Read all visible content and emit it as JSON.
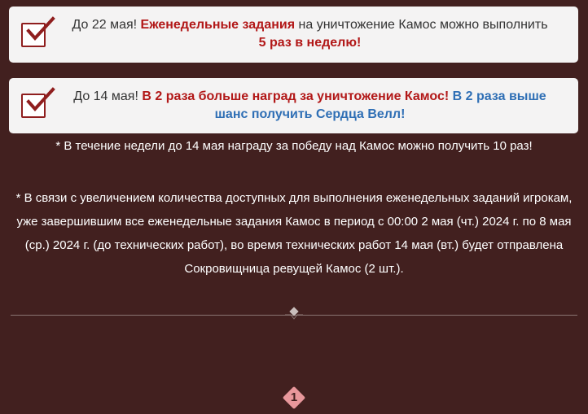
{
  "notice_1": {
    "prefix": "До 22 мая! ",
    "highlight_red": "Еженедельные задания",
    "middle": " на уничтожение Камос можно выполнить",
    "line2_red": "5 раз в неделю!"
  },
  "notice_2": {
    "prefix": "До 14 мая! ",
    "highlight_red": "В 2 раза больше наград за уничтожение Камос!",
    "space": " ",
    "highlight_blue": "В 2 раза выше шанс получить Сердца Велл!"
  },
  "footnote_1": "* В течение недели до 14 мая награду за победу над Камос можно получить 10 раз!",
  "footnote_2": "* В связи с увеличением количества доступных для выполнения еженедельных заданий игрокам, уже завершившим все еженедельные задания Камос в период с 00:00 2 мая (чт.) 2024 г. по 8 мая (ср.) 2024 г. (до технических работ), во время технических работ 14 мая (вт.) будет отправлена Сокровищница ревущей Камос (2 шт.).",
  "pagination": {
    "current_page": "1"
  },
  "colors": {
    "background": "#42201f",
    "card": "#f4f3f3",
    "accent_red": "#b21818",
    "accent_blue": "#2f6fb5",
    "page_badge": "#e8979b"
  },
  "icons": {
    "checkbox": "checkbox-checked-icon",
    "divider": "diamond-divider-icon"
  }
}
